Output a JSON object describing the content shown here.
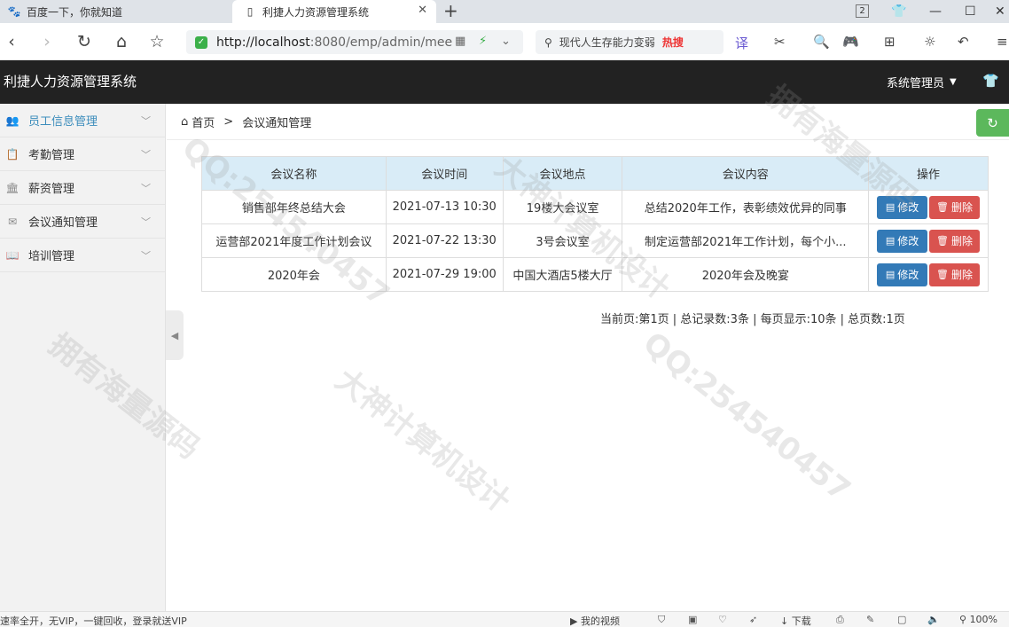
{
  "browser": {
    "tabs": [
      {
        "title": "百度一下，你就知道",
        "icon": "baidu-paw-icon"
      },
      {
        "title": "利捷人力资源管理系统",
        "icon": "page-icon"
      }
    ],
    "new_tab": "+",
    "tab_count": "2",
    "url_host": "http://localhost",
    "url_rest": ":8080/emp/admin/mee",
    "search_text": "现代人生存能力变弱",
    "search_hot": "热搜"
  },
  "app": {
    "title": "利捷人力资源管理系统",
    "user": "系统管理员"
  },
  "sidebar": {
    "items": [
      {
        "label": "员工信息管理",
        "icon": "users-icon",
        "active": true
      },
      {
        "label": "考勤管理",
        "icon": "clipboard-icon",
        "active": false
      },
      {
        "label": "薪资管理",
        "icon": "bank-icon",
        "active": false
      },
      {
        "label": "会议通知管理",
        "icon": "envelope-icon",
        "active": false
      },
      {
        "label": "培训管理",
        "icon": "book-icon",
        "active": false
      }
    ]
  },
  "breadcrumb": {
    "home": "首页",
    "separator": ">",
    "current": "会议通知管理"
  },
  "table": {
    "headers": [
      "会议名称",
      "会议时间",
      "会议地点",
      "会议内容",
      "操作"
    ],
    "rows": [
      {
        "name": "销售部年终总结大会",
        "time": "2021-07-13 10:30",
        "place": "19楼大会议室",
        "content": "总结2020年工作，表彰绩效优异的同事"
      },
      {
        "name": "运营部2021年度工作计划会议",
        "time": "2021-07-22 13:30",
        "place": "3号会议室",
        "content": "制定运营部2021年工作计划，每个小..."
      },
      {
        "name": "2020年会",
        "time": "2021-07-29 19:00",
        "place": "中国大酒店5楼大厅",
        "content": "2020年会及晚宴"
      }
    ],
    "edit_label": "修改",
    "delete_label": "删除"
  },
  "pager": "当前页:第1页 | 总记录数:3条 | 每页显示:10条 | 总页数:1页",
  "statusbar": {
    "left": "速率全开，无VIP，一键回收，登录就送VIP",
    "video": "我的视频",
    "download": "下载",
    "zoom": "100%"
  },
  "watermark": [
    "大神计算机设计",
    "QQ:254540457",
    "拥有海量源码"
  ]
}
